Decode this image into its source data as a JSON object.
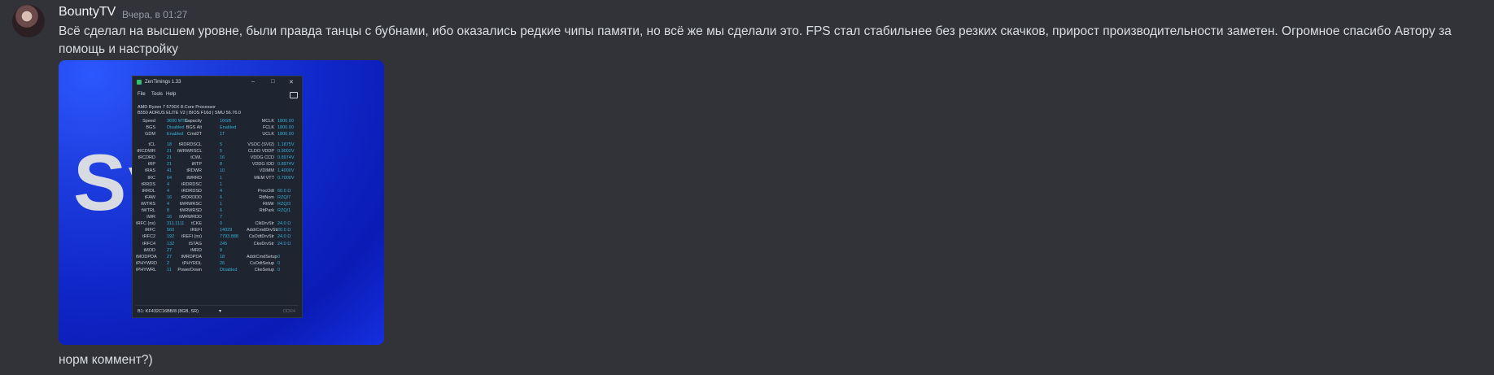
{
  "message": {
    "username": "BountyTV",
    "timestamp": "Вчера, в 01:27",
    "text": "Всё сделал на высшем уровне, были правда танцы с бубнами, ибо оказались редкие чипы памяти, но всё же мы сделали это. FPS стал стабильнее без резких скачков, прирост производительности заметен. Огромное спасибо Автору за помощь и настройку"
  },
  "attachment": {
    "brand_text": "Sy    nX",
    "zentimings": {
      "title": "ZenTimings 1.33",
      "window_controls": [
        "–",
        "□",
        "✕"
      ],
      "menu": [
        "File",
        "Tools",
        "Help"
      ],
      "cpu": "AMD Ryzen 7 5700X 8-Core Processor",
      "board": "B550 AORUS ELITE V2 | BIOS F16d | SMU 56.76.0",
      "header_rows": [
        [
          "Speed",
          "3600 MT/s",
          "Capacity",
          "16GB",
          "MCLK",
          "1800.00"
        ],
        [
          "BGS",
          "Disabled",
          "BGS Alt",
          "Enabled",
          "FCLK",
          "1800.00"
        ],
        [
          "GDM",
          "Enabled",
          "Cmd2T",
          "1T",
          "UCLK",
          "1800.00"
        ]
      ],
      "timing_rows": [
        [
          "tCL",
          "18",
          "tRDRDSCL",
          "5",
          "VSOC (SVI2)",
          "1.1875V"
        ],
        [
          "tRCDWR",
          "21",
          "tWRWRSCL",
          "5",
          "CLDO VDDP",
          "0.9002V"
        ],
        [
          "tRCDRD",
          "21",
          "tCWL",
          "16",
          "VDDG CCD",
          "0.8974V"
        ],
        [
          "tRP",
          "21",
          "tRTP",
          "8",
          "VDDG IOD",
          "0.8974V"
        ],
        [
          "tRAS",
          "41",
          "tRDWR",
          "10",
          "VDIMM",
          "1.4000V"
        ],
        [
          "tRC",
          "64",
          "tWRRD",
          "1",
          "MEM VTT",
          "0.7000V"
        ],
        [
          "tRRDS",
          "4",
          "tRDRDSC",
          "1",
          "",
          ""
        ],
        [
          "tRRDL",
          "4",
          "tRDRDSD",
          "4",
          "ProcOdt",
          "60.0 Ω"
        ],
        [
          "tFAW",
          "16",
          "tRDRDDD",
          "6",
          "RttNom",
          "RZQ/7"
        ],
        [
          "tWTRS",
          "4",
          "tWRWRSC",
          "1",
          "RttWr",
          "RZQ/3"
        ],
        [
          "tWTRL",
          "8",
          "tWRWRSD",
          "6",
          "RttPark",
          "RZQ/1"
        ],
        [
          "tWR",
          "16",
          "tWRWRDD",
          "7",
          "",
          ""
        ],
        [
          "tRFC (ns)",
          "311.1111",
          "tCKE",
          "0",
          "ClkDrvStr",
          "24.0 Ω"
        ],
        [
          "tRFC",
          "560",
          "tREFI",
          "14029",
          "AddrCmdDrvStr",
          "20.0 Ω"
        ],
        [
          "tRFC2",
          "192",
          "tREFI (ns)",
          "7793.888",
          "CsOdtDrvStr",
          "24.0 Ω"
        ],
        [
          "tRFC4",
          "132",
          "tSTAG",
          "245",
          "CkeDrvStr",
          "24.0 Ω"
        ],
        [
          "tMOD",
          "27",
          "tMRD",
          "8",
          "",
          ""
        ],
        [
          "tMODPDA",
          "27",
          "tMRDPDA",
          "18",
          "AddrCmdSetup",
          "0"
        ],
        [
          "tPHYWRD",
          "2",
          "tPHYRDL",
          "26",
          "CsOdtSetup",
          "0"
        ],
        [
          "tPHYWRL",
          "11",
          "PowerDown",
          "Disabled",
          "CkeSetup",
          "0"
        ]
      ],
      "dimm": "B1: KF432C16BB/8 (8GB, SR)",
      "version": "DDR4"
    }
  },
  "message2": {
    "text": "норм коммент?)"
  }
}
